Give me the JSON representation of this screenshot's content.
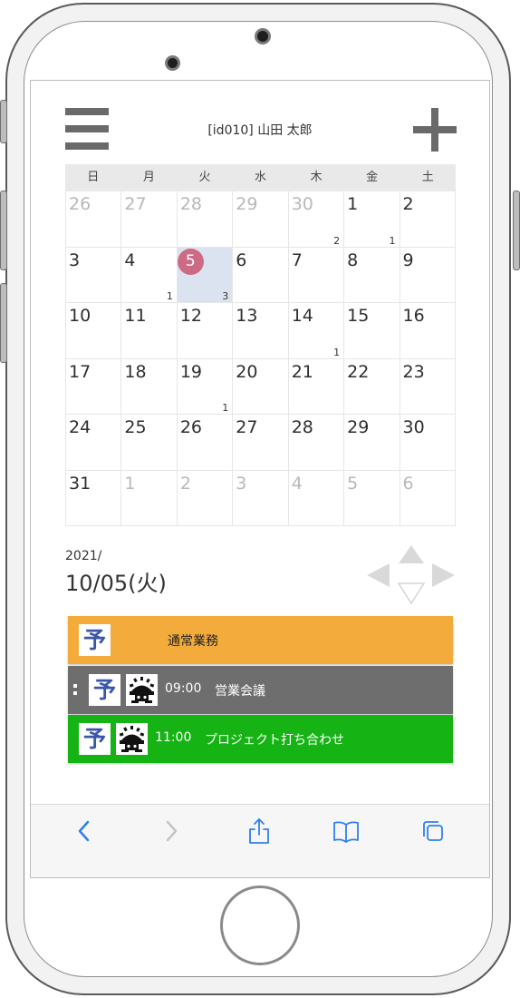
{
  "header": {
    "user_label": "[id010] 山田 太郎",
    "menu_icon": "hamburger-menu-icon",
    "add_icon": "plus-icon"
  },
  "calendar": {
    "weekdays": [
      "日",
      "月",
      "火",
      "水",
      "木",
      "金",
      "土"
    ],
    "weeks": [
      [
        {
          "d": "26",
          "other": true
        },
        {
          "d": "27",
          "other": true
        },
        {
          "d": "28",
          "other": true
        },
        {
          "d": "29",
          "other": true
        },
        {
          "d": "30",
          "other": true,
          "count": "2"
        },
        {
          "d": "1",
          "count": "1"
        },
        {
          "d": "2"
        }
      ],
      [
        {
          "d": "3"
        },
        {
          "d": "4",
          "count": "1"
        },
        {
          "d": "5",
          "today": true,
          "selected": true,
          "count": "3"
        },
        {
          "d": "6"
        },
        {
          "d": "7"
        },
        {
          "d": "8"
        },
        {
          "d": "9"
        }
      ],
      [
        {
          "d": "10"
        },
        {
          "d": "11"
        },
        {
          "d": "12"
        },
        {
          "d": "13"
        },
        {
          "d": "14",
          "count": "1"
        },
        {
          "d": "15"
        },
        {
          "d": "16"
        }
      ],
      [
        {
          "d": "17"
        },
        {
          "d": "18"
        },
        {
          "d": "19",
          "count": "1"
        },
        {
          "d": "20"
        },
        {
          "d": "21"
        },
        {
          "d": "22"
        },
        {
          "d": "23"
        }
      ],
      [
        {
          "d": "24"
        },
        {
          "d": "25"
        },
        {
          "d": "26"
        },
        {
          "d": "27"
        },
        {
          "d": "28"
        },
        {
          "d": "29"
        },
        {
          "d": "30"
        }
      ],
      [
        {
          "d": "31"
        },
        {
          "d": "1",
          "other": true
        },
        {
          "d": "2",
          "other": true
        },
        {
          "d": "3",
          "other": true
        },
        {
          "d": "4",
          "other": true
        },
        {
          "d": "5",
          "other": true
        },
        {
          "d": "6",
          "other": true
        }
      ]
    ],
    "colors": {
      "today": "#cd6b86",
      "selected": "#dbe3f1",
      "weekday_bg": "#e9e9e9"
    }
  },
  "selected_date": {
    "year": "2021/",
    "date": "10/05(火)"
  },
  "events": [
    {
      "badge": "予",
      "time": "",
      "title": "通常業務",
      "color": "#f3ab3b"
    },
    {
      "badge": "予",
      "time": "09:00",
      "title": "営業会議",
      "color": "#6e6e6e"
    },
    {
      "badge": "予",
      "time": "11:00",
      "title": "プロジェクト打ち合わせ",
      "color": "#15b313"
    }
  ],
  "toolbar": {
    "icons": [
      "back-arrow-icon",
      "forward-arrow-icon",
      "share-icon",
      "bookmarks-icon",
      "tabs-icon"
    ]
  }
}
